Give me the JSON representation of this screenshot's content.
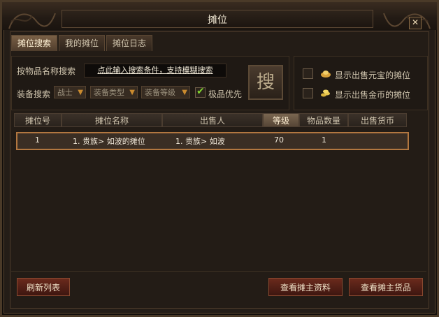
{
  "window": {
    "title": "摊位",
    "close_glyph": "✕"
  },
  "tabs": [
    {
      "label": "摊位搜索",
      "active": true
    },
    {
      "label": "我的摊位",
      "active": false
    },
    {
      "label": "摊位日志",
      "active": false
    }
  ],
  "search": {
    "name_label": "按物品名称搜索",
    "name_placeholder": "点此输入搜索条件，支持模糊搜索",
    "equip_label": "装备搜索",
    "class_dropdown": "战士",
    "type_dropdown": "装备类型",
    "level_dropdown": "装备等级",
    "quality_first_label": "极品优先",
    "quality_first_checked": true,
    "search_button": "搜"
  },
  "filters": {
    "yuanbao_label": "显示出售元宝的摊位",
    "gold_label": "显示出售金币的摊位"
  },
  "table": {
    "columns": [
      "摊位号",
      "摊位名称",
      "出售人",
      "等级",
      "物品数量",
      "出售货币"
    ],
    "sorted_column": "等级",
    "rows": [
      {
        "stall_no": "1",
        "stall_name": "1. 贵族> 如波的摊位",
        "seller": "1. 贵族> 如波",
        "level": "70",
        "item_count": "1",
        "currency": ""
      }
    ]
  },
  "buttons": {
    "refresh": "刷新列表",
    "view_owner": "查看摊主资料",
    "view_goods": "查看摊主货品"
  },
  "colors": {
    "accent": "#c98a2e",
    "row_border": "#b27740",
    "check": "#7fd12e",
    "button_red": "#6a2a1c"
  }
}
